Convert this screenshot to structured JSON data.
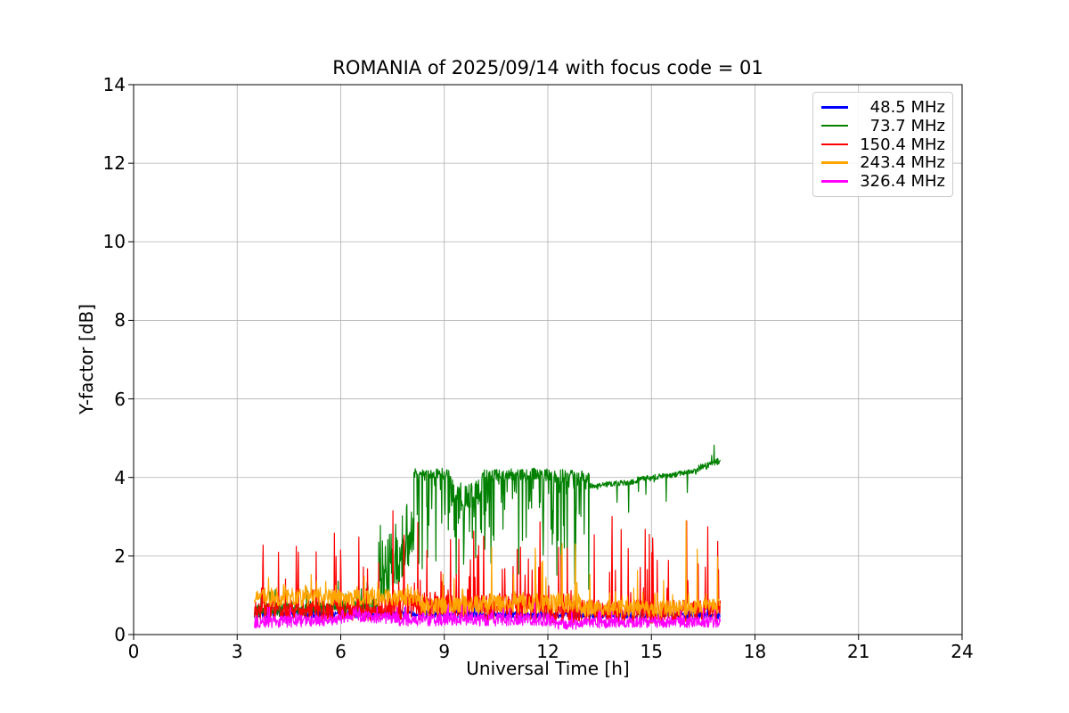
{
  "chart_data": {
    "type": "line",
    "title": "ROMANIA of 2025/09/14 with focus code = 01",
    "xlabel": "Universal Time [h]",
    "ylabel": "Y-factor [dB]",
    "xlim": [
      0,
      24
    ],
    "ylim": [
      0,
      14
    ],
    "xticks": [
      "0",
      "3",
      "6",
      "9",
      "12",
      "15",
      "18",
      "21",
      "24"
    ],
    "ytick_values": [
      0,
      2,
      4,
      6,
      8,
      10,
      12,
      14
    ],
    "xtick_values": [
      0,
      3,
      6,
      9,
      12,
      15,
      18,
      21,
      24
    ],
    "yticks": [
      "0",
      "2",
      "4",
      "6",
      "8",
      "10",
      "12",
      "14"
    ],
    "grid": true,
    "grid_color": "#b0b0b0",
    "legend_position": "upper right",
    "data_x_start_h": 3.5,
    "data_x_end_h": 17.0,
    "sample_step_h": 0.012,
    "noise_seed": 7,
    "series": [
      {
        "name": "48.5 MHz",
        "color": "#0000ff",
        "summary": "flat noisy baseline ~0.5 dB, mostly hidden under other traces",
        "segments": [
          {
            "x0": 3.5,
            "x1": 17.0,
            "b0": 0.52,
            "b1": 0.5,
            "j": 0.1,
            "sa": 0.3,
            "sp": 0.05,
            "sd": 1
          }
        ]
      },
      {
        "name": "73.7 MHz",
        "color": "#008000",
        "summary": "low ~0.6 dB until 7.1h, noisy rise, step to ~4.1 dB plateau at 8.1h with deep downward dips, smooth slow rise 3.8->4.45 dB from 13.2h to 17h",
        "segments": [
          {
            "x0": 3.5,
            "x1": 7.1,
            "b0": 0.6,
            "b1": 0.75,
            "j": 0.18,
            "sa": 0.7,
            "sp": 0.07,
            "sd": 1
          },
          {
            "x0": 7.1,
            "x1": 8.12,
            "b0": 1.1,
            "b1": 2.4,
            "j": 0.55,
            "sa": 1.3,
            "sp": 0.3,
            "sd": 1
          },
          {
            "x0": 8.12,
            "x1": 9.2,
            "b0": 4.1,
            "b1": 4.1,
            "j": 0.14,
            "sa": 2.4,
            "sp": 0.2,
            "sd": -1
          },
          {
            "x0": 9.2,
            "x1": 10.1,
            "b0": 3.6,
            "b1": 3.6,
            "j": 0.35,
            "sa": 2.0,
            "sp": 0.3,
            "sd": -1
          },
          {
            "x0": 10.1,
            "x1": 11.9,
            "b0": 4.05,
            "b1": 4.1,
            "j": 0.15,
            "sa": 2.5,
            "sp": 0.25,
            "sd": -1
          },
          {
            "x0": 11.9,
            "x1": 13.2,
            "b0": 4.05,
            "b1": 4.0,
            "j": 0.18,
            "sa": 3.4,
            "sp": 0.28,
            "sd": -1
          },
          {
            "x0": 13.2,
            "x1": 14.6,
            "b0": 3.78,
            "b1": 3.9,
            "j": 0.07,
            "sa": 1.0,
            "sp": 0.06,
            "sd": -1
          },
          {
            "x0": 14.6,
            "x1": 16.3,
            "b0": 3.95,
            "b1": 4.15,
            "j": 0.07,
            "sa": 0.7,
            "sp": 0.06,
            "sd": -1
          },
          {
            "x0": 16.3,
            "x1": 17.0,
            "b0": 4.2,
            "b1": 4.42,
            "j": 0.09,
            "sa": 0.45,
            "sp": 0.1,
            "sd": 1
          }
        ]
      },
      {
        "name": "150.4 MHz",
        "color": "#ff0000",
        "summary": "noisy ~0.6 dB baseline with frequent upward spikes 1.5-3.3 dB over whole 3.5-17h span",
        "segments": [
          {
            "x0": 3.5,
            "x1": 7.2,
            "b0": 0.62,
            "b1": 0.62,
            "j": 0.28,
            "sa": 2.0,
            "sp": 0.15,
            "sd": 1
          },
          {
            "x0": 7.2,
            "x1": 8.4,
            "b0": 0.68,
            "b1": 0.68,
            "j": 0.35,
            "sa": 2.6,
            "sp": 0.18,
            "sd": 1
          },
          {
            "x0": 8.4,
            "x1": 12.0,
            "b0": 0.7,
            "b1": 0.7,
            "j": 0.35,
            "sa": 1.9,
            "sp": 0.17,
            "sd": 1
          },
          {
            "x0": 12.0,
            "x1": 17.0,
            "b0": 0.58,
            "b1": 0.58,
            "j": 0.3,
            "sa": 2.3,
            "sp": 0.14,
            "sd": 1
          }
        ]
      },
      {
        "name": "243.4 MHz",
        "color": "#ffa500",
        "summary": "band ~0.7-1.2 dB until 8.3h, then ~0.7 dB with occasional spikes up to ~2.9 dB",
        "segments": [
          {
            "x0": 3.5,
            "x1": 8.3,
            "b0": 0.93,
            "b1": 0.95,
            "j": 0.22,
            "sa": 0.4,
            "sp": 0.12,
            "sd": 1
          },
          {
            "x0": 8.3,
            "x1": 10.3,
            "b0": 0.72,
            "b1": 0.75,
            "j": 0.25,
            "sa": 1.0,
            "sp": 0.08,
            "sd": 1
          },
          {
            "x0": 10.3,
            "x1": 13.0,
            "b0": 0.8,
            "b1": 0.78,
            "j": 0.26,
            "sa": 1.6,
            "sp": 0.1,
            "sd": 1
          },
          {
            "x0": 13.0,
            "x1": 15.8,
            "b0": 0.68,
            "b1": 0.66,
            "j": 0.22,
            "sa": 1.1,
            "sp": 0.07,
            "sd": 1
          },
          {
            "x0": 15.8,
            "x1": 17.0,
            "b0": 0.7,
            "b1": 0.72,
            "j": 0.22,
            "sa": 2.3,
            "sp": 0.06,
            "sd": 1
          }
        ]
      },
      {
        "name": "326.4 MHz",
        "color": "#ff00ff",
        "summary": "lowest band ~0.15-0.55 dB across full span, slight hump near 6-7.5h",
        "segments": [
          {
            "x0": 3.5,
            "x1": 6.0,
            "b0": 0.3,
            "b1": 0.38,
            "j": 0.15,
            "sa": 0.3,
            "sp": 0.1,
            "sd": 1
          },
          {
            "x0": 6.0,
            "x1": 7.6,
            "b0": 0.44,
            "b1": 0.44,
            "j": 0.16,
            "sa": 0.3,
            "sp": 0.1,
            "sd": 1
          },
          {
            "x0": 7.6,
            "x1": 12.2,
            "b0": 0.38,
            "b1": 0.38,
            "j": 0.17,
            "sa": 0.35,
            "sp": 0.08,
            "sd": 1
          },
          {
            "x0": 12.2,
            "x1": 13.0,
            "b0": 0.26,
            "b1": 0.26,
            "j": 0.13,
            "sa": 0.25,
            "sp": 0.06,
            "sd": 1
          },
          {
            "x0": 13.0,
            "x1": 17.0,
            "b0": 0.3,
            "b1": 0.32,
            "j": 0.14,
            "sa": 0.3,
            "sp": 0.08,
            "sd": 1
          }
        ]
      }
    ]
  }
}
